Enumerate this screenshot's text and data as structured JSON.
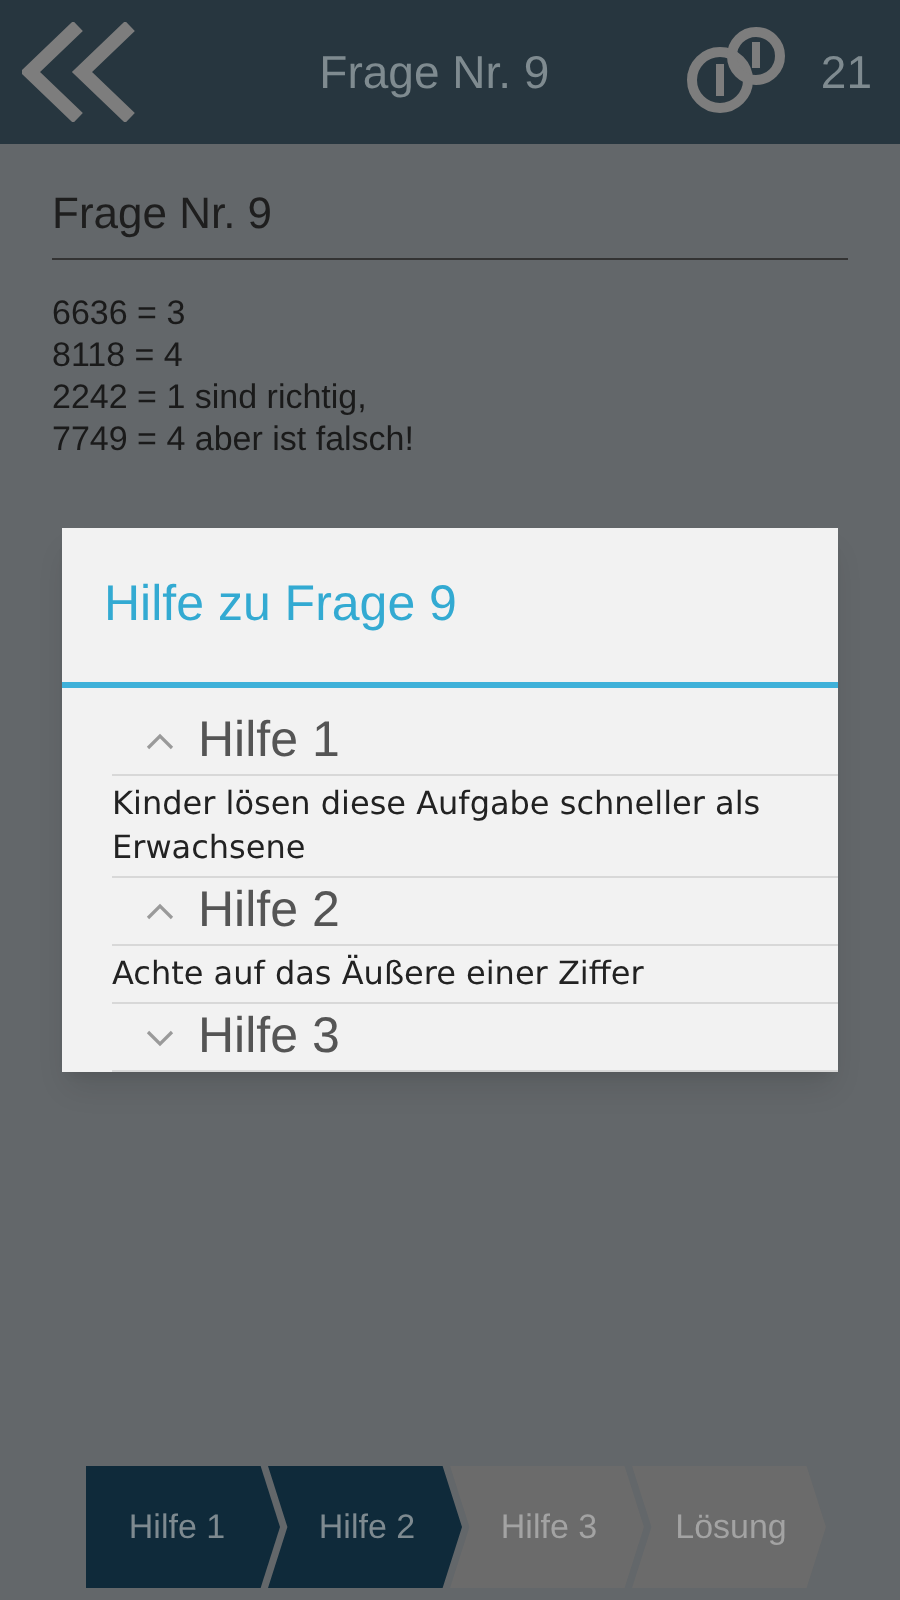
{
  "header": {
    "title": "Frage Nr. 9",
    "coins": "21"
  },
  "question": {
    "title": "Frage Nr. 9",
    "lines": [
      "6636 = 3",
      "8118 = 4",
      "2242 = 1 sind richtig,",
      "7749 = 4 aber ist falsch!"
    ]
  },
  "dialog": {
    "title": "Hilfe zu Frage 9",
    "items": [
      {
        "label": "Hilfe 1",
        "expanded": true,
        "text": "Kinder lösen diese Aufgabe schneller als Erwachsene"
      },
      {
        "label": "Hilfe 2",
        "expanded": true,
        "text": "Achte auf das Äußere einer Ziffer"
      },
      {
        "label": "Hilfe 3",
        "expanded": false
      }
    ]
  },
  "steps": [
    {
      "label": "Hilfe 1",
      "done": true
    },
    {
      "label": "Hilfe 2",
      "done": true
    },
    {
      "label": "Hilfe 3",
      "done": false
    },
    {
      "label": "Lösung",
      "done": false
    }
  ]
}
